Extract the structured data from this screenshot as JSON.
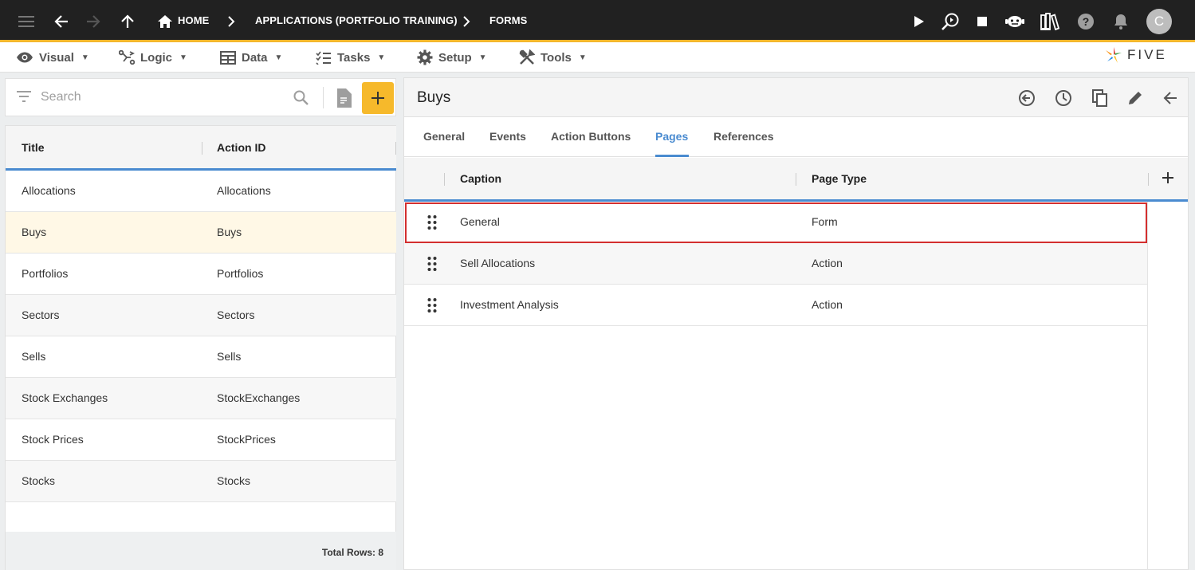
{
  "topbar": {
    "breadcrumbs": [
      "HOME",
      "APPLICATIONS (PORTFOLIO TRAINING)",
      "FORMS"
    ],
    "avatar_initial": "C",
    "accent_color": "#f3b62c"
  },
  "menubar": {
    "items": [
      {
        "label": "Visual",
        "icon": "eye-icon"
      },
      {
        "label": "Logic",
        "icon": "logic-icon"
      },
      {
        "label": "Data",
        "icon": "table-icon"
      },
      {
        "label": "Tasks",
        "icon": "checklist-icon"
      },
      {
        "label": "Setup",
        "icon": "gear-icon"
      },
      {
        "label": "Tools",
        "icon": "tools-icon"
      }
    ],
    "logo_text": "FIVE"
  },
  "left": {
    "search_placeholder": "Search",
    "columns": [
      "Title",
      "Action ID"
    ],
    "rows": [
      {
        "title": "Allocations",
        "action_id": "Allocations"
      },
      {
        "title": "Buys",
        "action_id": "Buys"
      },
      {
        "title": "Portfolios",
        "action_id": "Portfolios"
      },
      {
        "title": "Sectors",
        "action_id": "Sectors"
      },
      {
        "title": "Sells",
        "action_id": "Sells"
      },
      {
        "title": "Stock Exchanges",
        "action_id": "StockExchanges"
      },
      {
        "title": "Stock Prices",
        "action_id": "StockPrices"
      },
      {
        "title": "Stocks",
        "action_id": "Stocks"
      }
    ],
    "total_rows": "Total Rows: 8"
  },
  "right": {
    "title": "Buys",
    "tabs": [
      "General",
      "Events",
      "Action Buttons",
      "Pages",
      "References"
    ],
    "active_tab": "Pages",
    "columns": [
      "Caption",
      "Page Type"
    ],
    "rows": [
      {
        "caption": "General",
        "page_type": "Form"
      },
      {
        "caption": "Sell Allocations",
        "page_type": "Action"
      },
      {
        "caption": "Investment Analysis",
        "page_type": "Action"
      }
    ]
  }
}
